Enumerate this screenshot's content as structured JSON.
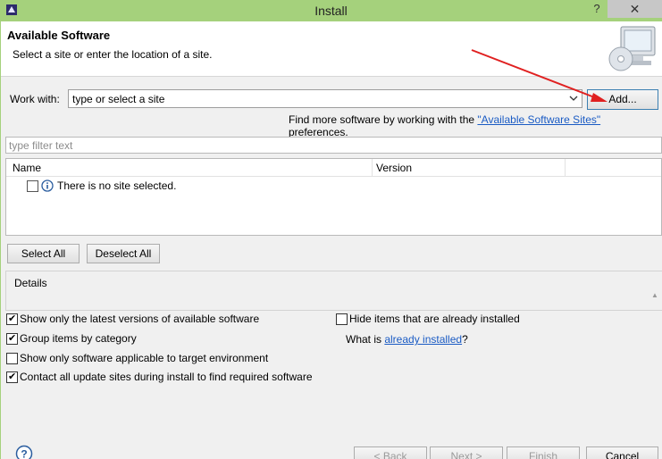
{
  "window": {
    "title": "Install",
    "help_glyph": "?",
    "close_glyph": "✕"
  },
  "banner": {
    "heading": "Available Software",
    "subtitle": "Select a site or enter the location of a site."
  },
  "work_with": {
    "label": "Work with:",
    "combo_value": "type or select a site",
    "add_button": "Add..."
  },
  "find_more": {
    "prefix": "Find more software by working with the ",
    "link": "\"Available Software Sites\"",
    "suffix": " preferences."
  },
  "filter": {
    "placeholder": "type filter text"
  },
  "table": {
    "columns": [
      "Name",
      "Version"
    ],
    "rows": [
      {
        "name": "There is no site selected."
      }
    ]
  },
  "buttons": {
    "select_all": "Select All",
    "deselect_all": "Deselect All"
  },
  "details": {
    "label": "Details"
  },
  "options": {
    "latest_versions": {
      "label": "Show only the latest versions of available software",
      "checked": true
    },
    "group_by_category": {
      "label": "Group items by category",
      "checked": true
    },
    "applicable_only": {
      "label": "Show only software applicable to target environment",
      "checked": false
    },
    "contact_sites": {
      "label": "Contact all update sites during install to find required software",
      "checked": true
    },
    "hide_installed": {
      "label": "Hide items that are already installed",
      "checked": false
    }
  },
  "what_is": {
    "prefix": "What is ",
    "link": "already installed",
    "suffix": "?"
  },
  "footer": {
    "back": "< Back",
    "next": "Next >",
    "finish": "Finish",
    "cancel": "Cancel"
  },
  "colors": {
    "titlebar": "#a5d17c",
    "link": "#1a5bc4",
    "annotation_arrow": "#e02020"
  },
  "icons": [
    "eclipse-app-icon",
    "monitor-cd-icon",
    "info-icon",
    "help-icon",
    "dropdown-arrow-icon"
  ]
}
